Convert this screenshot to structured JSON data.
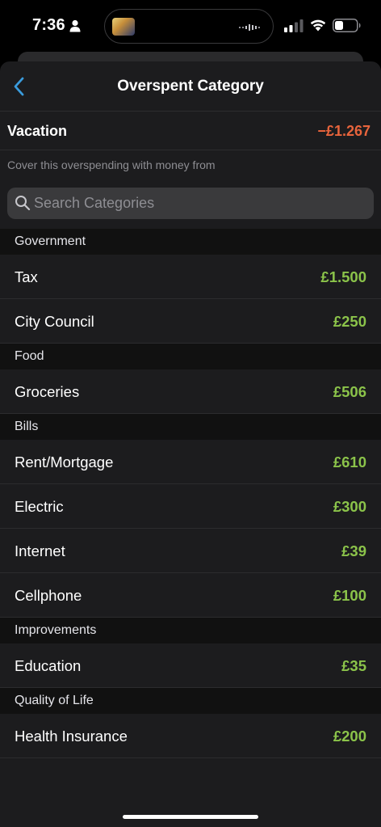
{
  "status_bar": {
    "time": "7:36"
  },
  "nav": {
    "title": "Overspent Category"
  },
  "overspent": {
    "name": "Vacation",
    "amount": "−£1.267",
    "amount_color": "#e8643c"
  },
  "cover_text": "Cover this overspending with money from",
  "search": {
    "placeholder": "Search Categories",
    "value": ""
  },
  "colors": {
    "positive_amount": "#8bc34a",
    "background": "#1c1c1e",
    "accent": "#3a9bdc"
  },
  "groups": [
    {
      "name": "Government",
      "items": [
        {
          "label": "Tax",
          "amount": "£1.500"
        },
        {
          "label": "City Council",
          "amount": "£250"
        }
      ]
    },
    {
      "name": "Food",
      "items": [
        {
          "label": "Groceries",
          "amount": "£506"
        }
      ]
    },
    {
      "name": "Bills",
      "items": [
        {
          "label": "Rent/Mortgage",
          "amount": "£610"
        },
        {
          "label": "Electric",
          "amount": "£300"
        },
        {
          "label": "Internet",
          "amount": "£39"
        },
        {
          "label": "Cellphone",
          "amount": "£100"
        }
      ]
    },
    {
      "name": "Improvements",
      "items": [
        {
          "label": "Education",
          "amount": "£35"
        }
      ]
    },
    {
      "name": "Quality of Life",
      "items": [
        {
          "label": "Health Insurance",
          "amount": "£200"
        }
      ]
    }
  ]
}
